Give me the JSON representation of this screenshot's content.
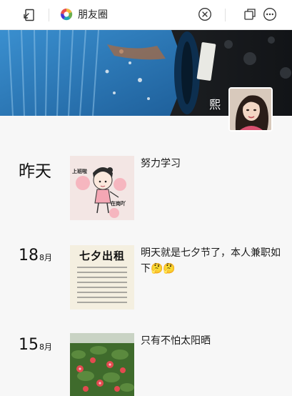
{
  "app": {
    "title": "朋友圈"
  },
  "toolbar": {
    "icons": [
      "collapse-icon",
      "moments-icon",
      "close-icon",
      "window-icon",
      "more-icon"
    ]
  },
  "profile": {
    "username": "熙"
  },
  "posts": [
    {
      "date_label": "昨天",
      "text": "努力学习",
      "image": {
        "kind": "sticker",
        "caption_top": "上班啦",
        "caption_bottom": "在岗吖"
      }
    },
    {
      "day": "18",
      "month": "8月",
      "text": "明天就是七夕节了，本人兼职如下🤔🤔",
      "image": {
        "kind": "poster",
        "title": "七夕出租"
      }
    },
    {
      "day": "15",
      "month": "8月",
      "text": "只有不怕太阳晒",
      "image": {
        "kind": "photo"
      }
    }
  ],
  "colors": {
    "bar_bg": "#ffffff",
    "page_bg": "#f7f7f7",
    "text": "#1a1a1a"
  }
}
